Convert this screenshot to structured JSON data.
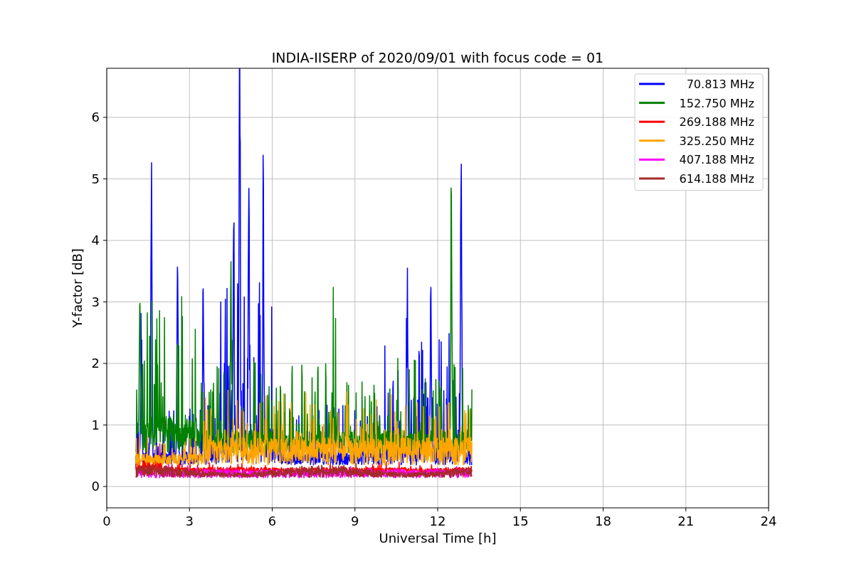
{
  "chart": {
    "title": "INDIA-IISERP of 2020/09/01 with focus code = 01",
    "xlabel": "Universal Time [h]",
    "ylabel": "Y-factor [dB]",
    "xticks": [
      "0",
      "3",
      "6",
      "9",
      "12",
      "15",
      "18",
      "21",
      "24"
    ],
    "yticks": [
      "6",
      "5",
      "4",
      "3",
      "2",
      "1",
      "0"
    ],
    "legend": [
      {
        "label": "70.813 MHz",
        "color": "#0000ff"
      },
      {
        "label": "152.750 MHz",
        "color": "#008000"
      },
      {
        "label": "269.188 MHz",
        "color": "#ff0000"
      },
      {
        "label": "325.250 MHz",
        "color": "#ffa500"
      },
      {
        "label": "407.188 MHz",
        "color": "#ff00ff"
      },
      {
        "label": "614.188 MHz",
        "color": "#a52a2a"
      }
    ]
  }
}
